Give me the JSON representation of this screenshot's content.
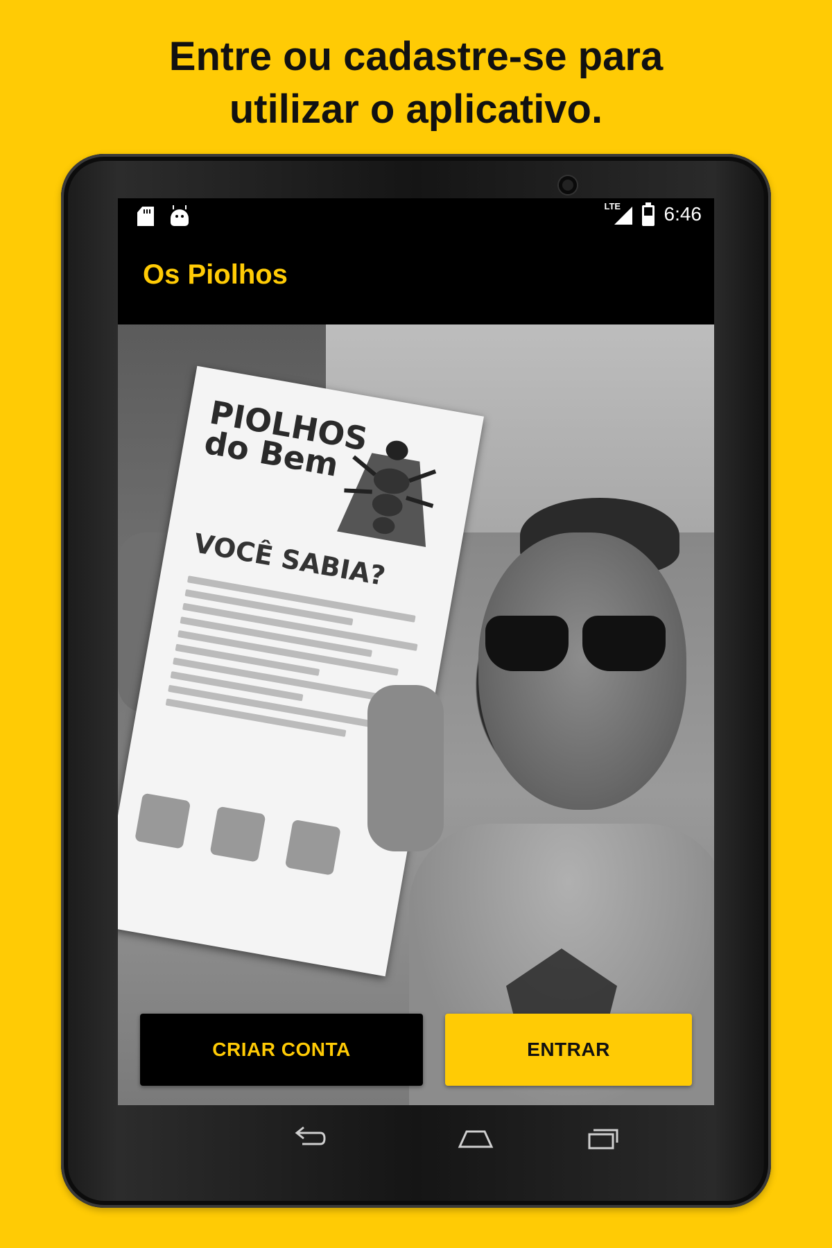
{
  "headline": {
    "line1": "Entre ou cadastre-se para",
    "line2": "utilizar o aplicativo."
  },
  "status_bar": {
    "left_icons": [
      "sd-card-icon",
      "android-debug-icon"
    ],
    "network_label": "LTE",
    "time": "6:46"
  },
  "app_bar": {
    "title": "Os Piolhos"
  },
  "hero": {
    "flyer_title": "PIOLHOS do Bem",
    "flyer_subtitle": "VOCÊ SABIA?"
  },
  "actions": {
    "create_account_label": "CRIAR CONTA",
    "login_label": "ENTRAR"
  },
  "nav_bar": {
    "icons": [
      "back-icon",
      "home-icon",
      "recent-apps-icon"
    ]
  },
  "colors": {
    "brand_yellow": "#FFCB05",
    "bar_black": "#000000"
  }
}
